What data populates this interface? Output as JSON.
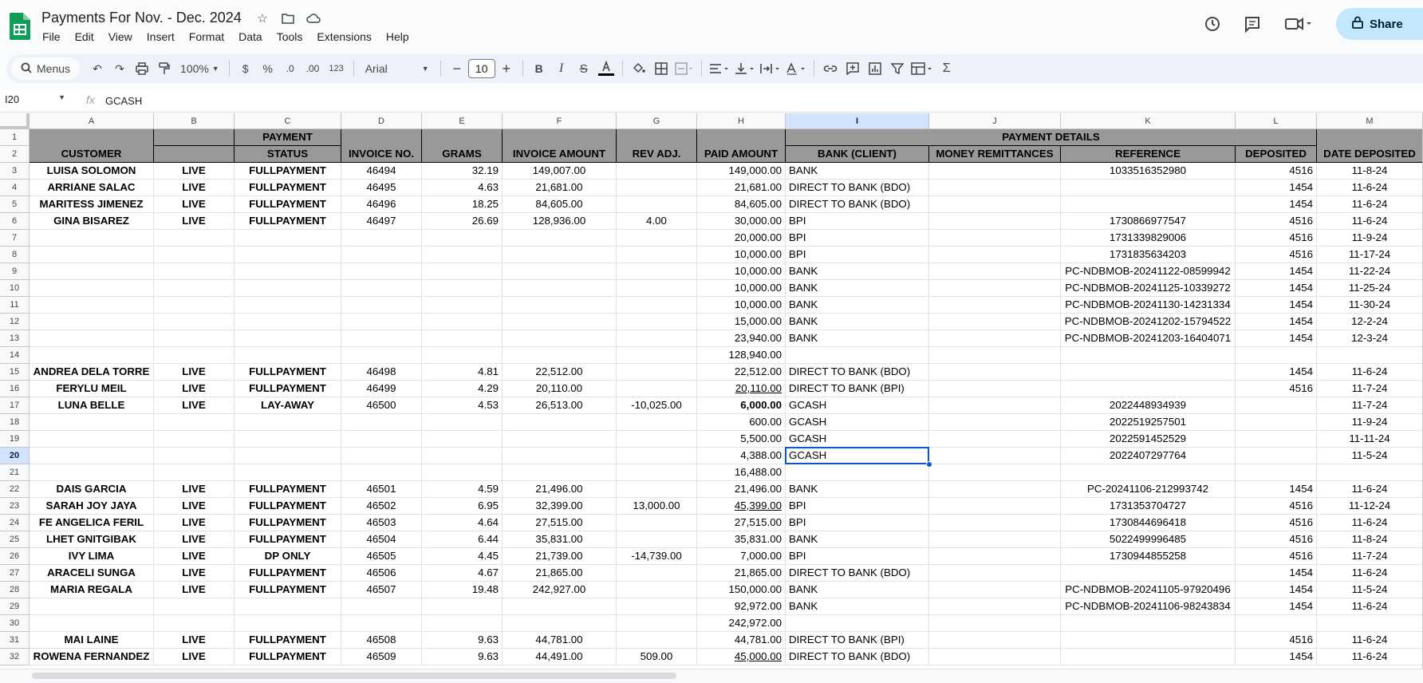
{
  "doc": {
    "title": "Payments For Nov. - Dec. 2024",
    "menus": [
      "File",
      "Edit",
      "View",
      "Insert",
      "Format",
      "Data",
      "Tools",
      "Extensions",
      "Help"
    ],
    "share_label": "Share"
  },
  "toolbar": {
    "menus_label": "Menus",
    "zoom": "100%",
    "currency": "$",
    "percent": "%",
    "dec_decrease": ".0",
    "dec_increase": ".00",
    "number_format": "123",
    "font": "Arial",
    "font_size": "10",
    "minus": "−",
    "plus": "+",
    "bold": "B",
    "italic": "I",
    "sum": "Σ"
  },
  "formula": {
    "cell_ref": "I20",
    "fx": "fx",
    "value": "GCASH"
  },
  "grid": {
    "columns": [
      "A",
      "B",
      "C",
      "D",
      "E",
      "F",
      "G",
      "H",
      "I",
      "J",
      "K",
      "L",
      "M"
    ],
    "selected_column": "I",
    "selected_row": "20",
    "header_row1": {
      "payment": "PAYMENT",
      "payment_details": "PAYMENT DETAILS"
    },
    "header_row2": [
      "CUSTOMER",
      "",
      "STATUS",
      "INVOICE NO.",
      "GRAMS",
      "INVOICE AMOUNT",
      "REV ADJ.",
      "PAID AMOUNT",
      "BANK (CLIENT)",
      "MONEY REMITTANCES",
      "REFERENCE",
      "DEPOSITED",
      "DATE DEPOSITED"
    ],
    "rows": [
      {
        "n": "3",
        "cells": [
          "LUISA SOLOMON",
          "LIVE",
          "FULLPAYMENT",
          "46494",
          "32.19",
          "149,007.00",
          "",
          "149,000.00",
          "BANK",
          "",
          "1033516352980",
          "4516",
          "11-8-24"
        ]
      },
      {
        "n": "4",
        "cells": [
          "ARRIANE SALAC",
          "LIVE",
          "FULLPAYMENT",
          "46495",
          "4.63",
          "21,681.00",
          "",
          "21,681.00",
          "DIRECT TO BANK (BDO)",
          "",
          "",
          "1454",
          "11-6-24"
        ]
      },
      {
        "n": "5",
        "cells": [
          "MARITESS JIMENEZ",
          "LIVE",
          "FULLPAYMENT",
          "46496",
          "18.25",
          "84,605.00",
          "",
          "84,605.00",
          "DIRECT TO BANK (BDO)",
          "",
          "",
          "1454",
          "11-6-24"
        ]
      },
      {
        "n": "6",
        "cells": [
          "GINA BISAREZ",
          "LIVE",
          "FULLPAYMENT",
          "46497",
          "26.69",
          "128,936.00",
          "4.00",
          "30,000.00",
          "BPI",
          "",
          "1730866977547",
          "4516",
          "11-6-24"
        ]
      },
      {
        "n": "7",
        "cells": [
          "",
          "",
          "",
          "",
          "",
          "",
          "",
          "20,000.00",
          "BPI",
          "",
          "1731339829006",
          "4516",
          "11-9-24"
        ]
      },
      {
        "n": "8",
        "cells": [
          "",
          "",
          "",
          "",
          "",
          "",
          "",
          "10,000.00",
          "BPI",
          "",
          "1731835634203",
          "4516",
          "11-17-24"
        ]
      },
      {
        "n": "9",
        "cells": [
          "",
          "",
          "",
          "",
          "",
          "",
          "",
          "10,000.00",
          "BANK",
          "",
          "PC-NDBMOB-20241122-08599942",
          "1454",
          "11-22-24"
        ]
      },
      {
        "n": "10",
        "cells": [
          "",
          "",
          "",
          "",
          "",
          "",
          "",
          "10,000.00",
          "BANK",
          "",
          "PC-NDBMOB-20241125-10339272",
          "1454",
          "11-25-24"
        ]
      },
      {
        "n": "11",
        "cells": [
          "",
          "",
          "",
          "",
          "",
          "",
          "",
          "10,000.00",
          "BANK",
          "",
          "PC-NDBMOB-20241130-14231334",
          "1454",
          "11-30-24"
        ]
      },
      {
        "n": "12",
        "cells": [
          "",
          "",
          "",
          "",
          "",
          "",
          "",
          "15,000.00",
          "BANK",
          "",
          "PC-NDBMOB-20241202-15794522",
          "1454",
          "12-2-24"
        ]
      },
      {
        "n": "13",
        "cells": [
          "",
          "",
          "",
          "",
          "",
          "",
          "",
          "23,940.00",
          "BANK",
          "",
          "PC-NDBMOB-20241203-16404071",
          "1454",
          "12-3-24"
        ]
      },
      {
        "n": "14",
        "cells": [
          "",
          "",
          "",
          "",
          "",
          "",
          "",
          "128,940.00",
          "",
          "",
          "",
          "",
          ""
        ]
      },
      {
        "n": "15",
        "cells": [
          "ANDREA DELA TORRE",
          "LIVE",
          "FULLPAYMENT",
          "46498",
          "4.81",
          "22,512.00",
          "",
          "22,512.00",
          "DIRECT TO BANK (BDO)",
          "",
          "",
          "1454",
          "11-6-24"
        ]
      },
      {
        "n": "16",
        "cells": [
          "FERYLU MEIL",
          "LIVE",
          "FULLPAYMENT",
          "46499",
          "4.29",
          "20,110.00",
          "",
          "20,110.00",
          "DIRECT TO BANK (BPI)",
          "",
          "",
          "4516",
          "11-7-24"
        ]
      },
      {
        "n": "17",
        "cells": [
          "LUNA BELLE",
          "LIVE",
          "LAY-AWAY",
          "46500",
          "4.53",
          "26,513.00",
          "-10,025.00",
          "6,000.00",
          "GCASH",
          "",
          "2022448934939",
          "",
          "11-7-24"
        ]
      },
      {
        "n": "18",
        "cells": [
          "",
          "",
          "",
          "",
          "",
          "",
          "",
          "600.00",
          "GCASH",
          "",
          "2022519257501",
          "",
          "11-9-24"
        ]
      },
      {
        "n": "19",
        "cells": [
          "",
          "",
          "",
          "",
          "",
          "",
          "",
          "5,500.00",
          "GCASH",
          "",
          "2022591452529",
          "",
          "11-11-24"
        ]
      },
      {
        "n": "20",
        "cells": [
          "",
          "",
          "",
          "",
          "",
          "",
          "",
          "4,388.00",
          "GCASH",
          "",
          "2022407297764",
          "",
          "11-5-24"
        ]
      },
      {
        "n": "21",
        "cells": [
          "",
          "",
          "",
          "",
          "",
          "",
          "",
          "16,488.00",
          "",
          "",
          "",
          "",
          ""
        ]
      },
      {
        "n": "22",
        "cells": [
          "DAIS GARCIA",
          "LIVE",
          "FULLPAYMENT",
          "46501",
          "4.59",
          "21,496.00",
          "",
          "21,496.00",
          "BANK",
          "",
          "PC-20241106-212993742",
          "1454",
          "11-6-24"
        ]
      },
      {
        "n": "23",
        "cells": [
          "SARAH JOY JAYA",
          "LIVE",
          "FULLPAYMENT",
          "46502",
          "6.95",
          "32,399.00",
          "13,000.00",
          "45,399.00",
          "BPI",
          "",
          "1731353704727",
          "4516",
          "11-12-24"
        ]
      },
      {
        "n": "24",
        "cells": [
          "FE ANGELICA FERIL",
          "LIVE",
          "FULLPAYMENT",
          "46503",
          "4.64",
          "27,515.00",
          "",
          "27,515.00",
          "BPI",
          "",
          "1730844696418",
          "4516",
          "11-6-24"
        ]
      },
      {
        "n": "25",
        "cells": [
          "LHET GNITGIBAK",
          "LIVE",
          "FULLPAYMENT",
          "46504",
          "6.44",
          "35,831.00",
          "",
          "35,831.00",
          "BANK",
          "",
          "5022499996485",
          "4516",
          "11-8-24"
        ]
      },
      {
        "n": "26",
        "cells": [
          "IVY LIMA",
          "LIVE",
          "DP ONLY",
          "46505",
          "4.45",
          "21,739.00",
          "-14,739.00",
          "7,000.00",
          "BPI",
          "",
          "1730944855258",
          "4516",
          "11-7-24"
        ]
      },
      {
        "n": "27",
        "cells": [
          "ARACELI SUNGA",
          "LIVE",
          "FULLPAYMENT",
          "46506",
          "4.67",
          "21,865.00",
          "",
          "21,865.00",
          "DIRECT TO BANK (BDO)",
          "",
          "",
          "1454",
          "11-6-24"
        ]
      },
      {
        "n": "28",
        "cells": [
          "MARIA REGALA",
          "LIVE",
          "FULLPAYMENT",
          "46507",
          "19.48",
          "242,927.00",
          "",
          "150,000.00",
          "BANK",
          "",
          "PC-NDBMOB-20241105-97920496",
          "1454",
          "11-5-24"
        ]
      },
      {
        "n": "29",
        "cells": [
          "",
          "",
          "",
          "",
          "",
          "",
          "",
          "92,972.00",
          "BANK",
          "",
          "PC-NDBMOB-20241106-98243834",
          "1454",
          "11-6-24"
        ]
      },
      {
        "n": "30",
        "cells": [
          "",
          "",
          "",
          "",
          "",
          "",
          "",
          "242,972.00",
          "",
          "",
          "",
          "",
          ""
        ]
      },
      {
        "n": "31",
        "cells": [
          "MAI LAINE",
          "LIVE",
          "FULLPAYMENT",
          "46508",
          "9.63",
          "44,781.00",
          "",
          "44,781.00",
          "DIRECT TO BANK (BPI)",
          "",
          "",
          "4516",
          "11-6-24"
        ]
      },
      {
        "n": "32",
        "cells": [
          "ROWENA FERNANDEZ",
          "LIVE",
          "FULLPAYMENT",
          "46509",
          "9.63",
          "44,491.00",
          "509.00",
          "45,000.00",
          "DIRECT TO BANK (BDO)",
          "",
          "",
          "1454",
          "11-6-24"
        ]
      }
    ],
    "underlined_cells": [
      "13-7",
      "20-7",
      "29-7"
    ],
    "bold_cells": [
      "6-5",
      "14-7"
    ]
  }
}
